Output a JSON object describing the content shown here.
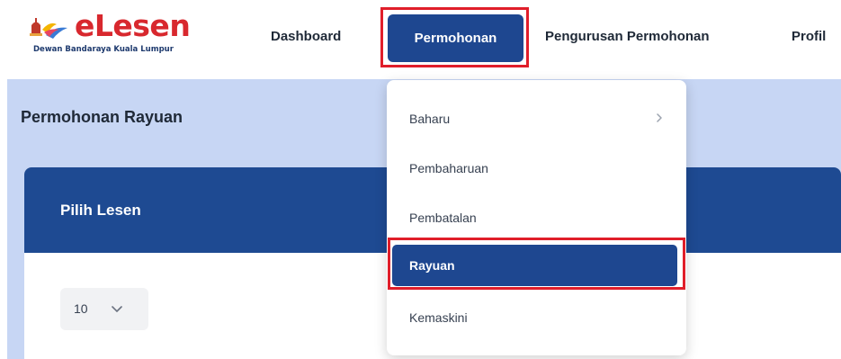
{
  "brand": {
    "name": "eLesen",
    "subtitle": "Dewan Bandaraya Kuala Lumpur",
    "colors": {
      "red": "#d8282e",
      "navy": "#1e3a6e"
    }
  },
  "nav": {
    "items": [
      "Dashboard",
      "Permohonan",
      "Pengurusan Permohonan",
      "Profil"
    ],
    "active_index": 1,
    "active_color": "#1e4790"
  },
  "page": {
    "title": "Permohonan Rayuan",
    "band_color": "#c7d6f4"
  },
  "card": {
    "title": "Pilih Lesen",
    "header_color": "#1e4a92",
    "page_size": {
      "value": "10",
      "icon": "chevron-down-icon"
    }
  },
  "dropdown": {
    "items": [
      {
        "label": "Baharu",
        "icon": "chevron-right-icon"
      },
      {
        "label": "Pembaharuan"
      },
      {
        "label": "Pembatalan"
      },
      {
        "label": "Rayuan",
        "active": true
      },
      {
        "label": "Kemaskini"
      }
    ]
  },
  "highlight_color": "#e01e2a"
}
